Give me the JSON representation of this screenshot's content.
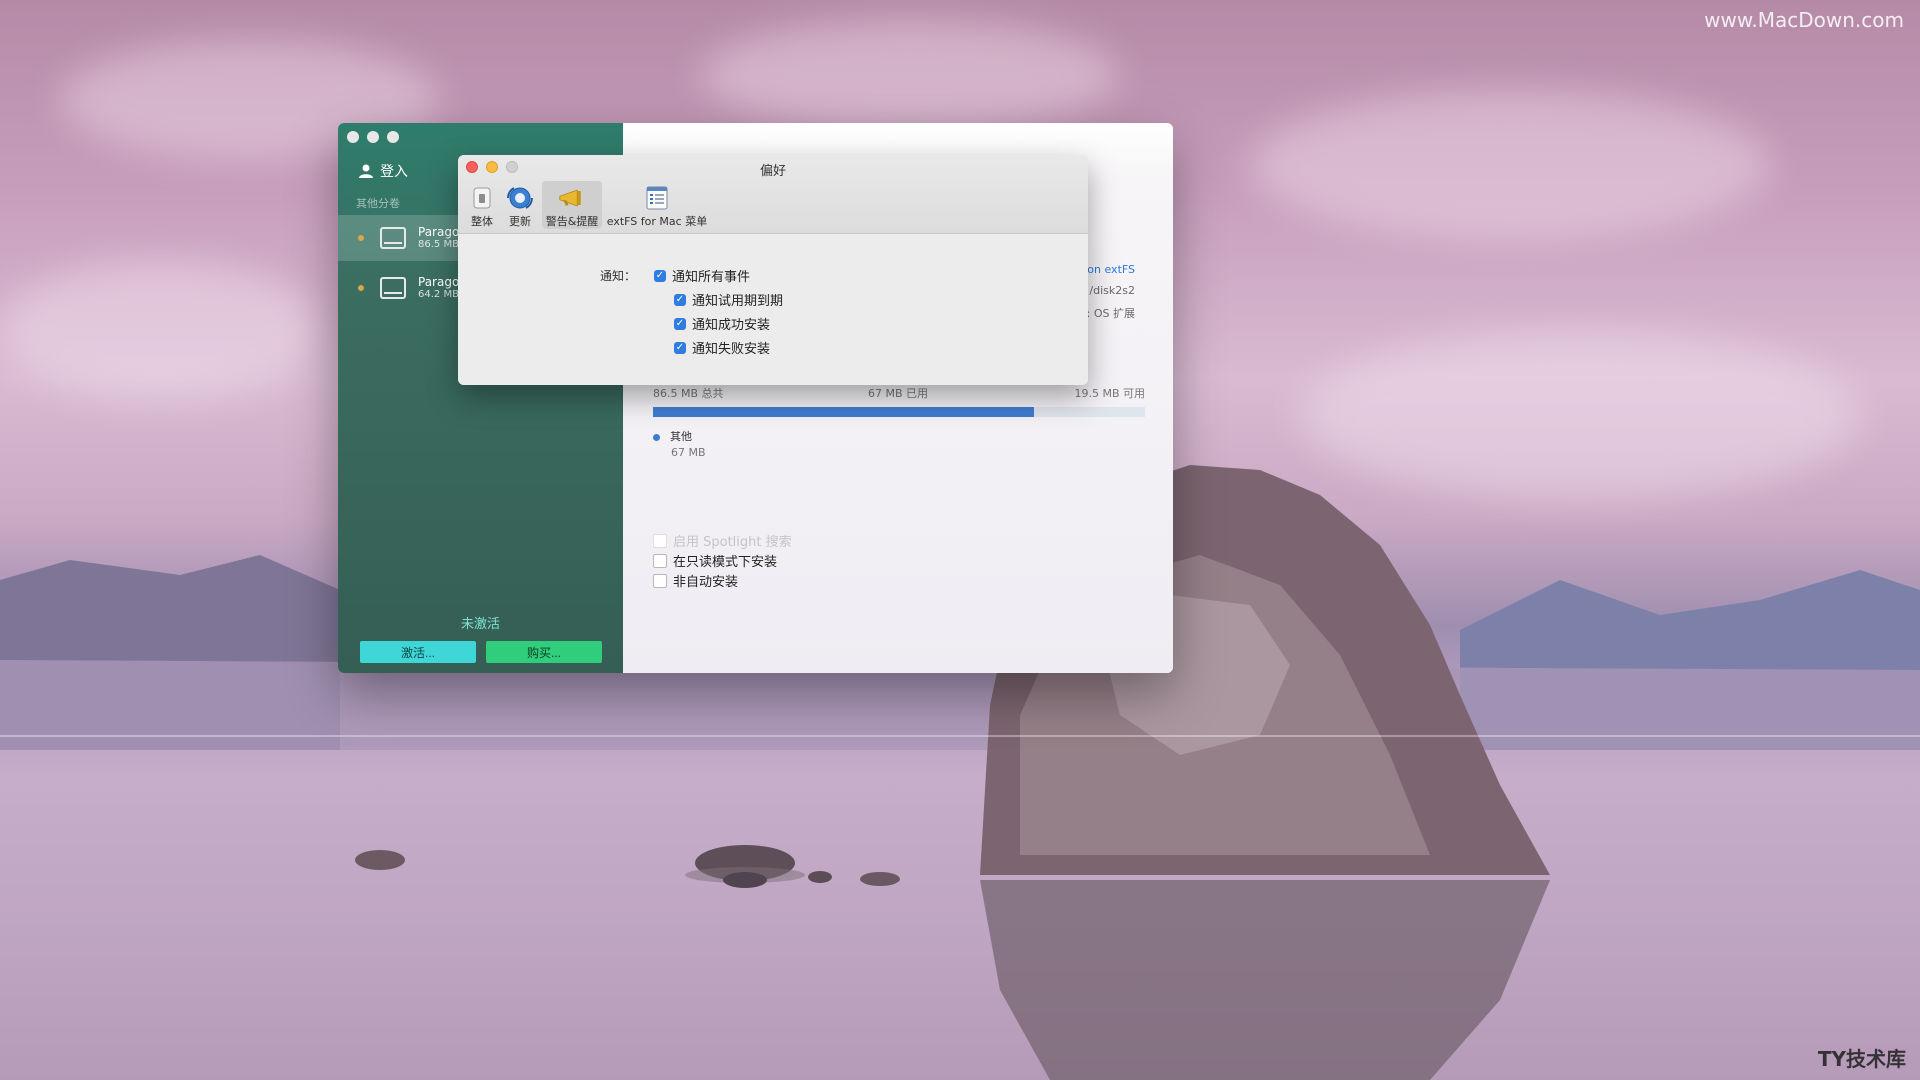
{
  "watermark": {
    "top": "www.MacDown.com",
    "bottom": "TY技术库"
  },
  "sidebar": {
    "login_label": "登入",
    "section_label": "其他分卷",
    "volumes": [
      {
        "name": "Parago",
        "size": "86.5 MB"
      },
      {
        "name": "Parago",
        "size": "64.2 MB"
      }
    ],
    "status": "未激活",
    "activate_label": "激活...",
    "buy_label": "购买..."
  },
  "main": {
    "info_lines": [
      "on extFS",
      "/disk2s2",
      ": OS 扩展"
    ],
    "storage": {
      "total": "86.5 MB 总共",
      "used": "67 MB 已用",
      "free": "19.5 MB 可用",
      "used_fraction": 0.775
    },
    "legend": {
      "name": "其他",
      "size": "67 MB"
    },
    "options": [
      {
        "label": "启用 Spotlight 搜索",
        "disabled": true
      },
      {
        "label": "在只读模式下安装",
        "disabled": false
      },
      {
        "label": "非自动安装",
        "disabled": false
      }
    ]
  },
  "prefs": {
    "title": "偏好",
    "toolbar": [
      {
        "label": "整体",
        "icon": "switch-icon"
      },
      {
        "label": "更新",
        "icon": "update-globe-icon"
      },
      {
        "label": "警告&提醒",
        "icon": "megaphone-icon"
      },
      {
        "label": "extFS for Mac 菜单",
        "icon": "menu-list-icon"
      }
    ],
    "notify_label": "通知：",
    "checks": [
      {
        "label": "通知所有事件",
        "checked": true
      },
      {
        "label": "通知试用期到期",
        "checked": true
      },
      {
        "label": "通知成功安装",
        "checked": true
      },
      {
        "label": "通知失败安装",
        "checked": true
      }
    ]
  },
  "colors": {
    "sidebar_teal": "#3b6d60",
    "activate": "#3fd6d8",
    "buy": "#2fcd7c",
    "accent_blue": "#2f7de1"
  }
}
